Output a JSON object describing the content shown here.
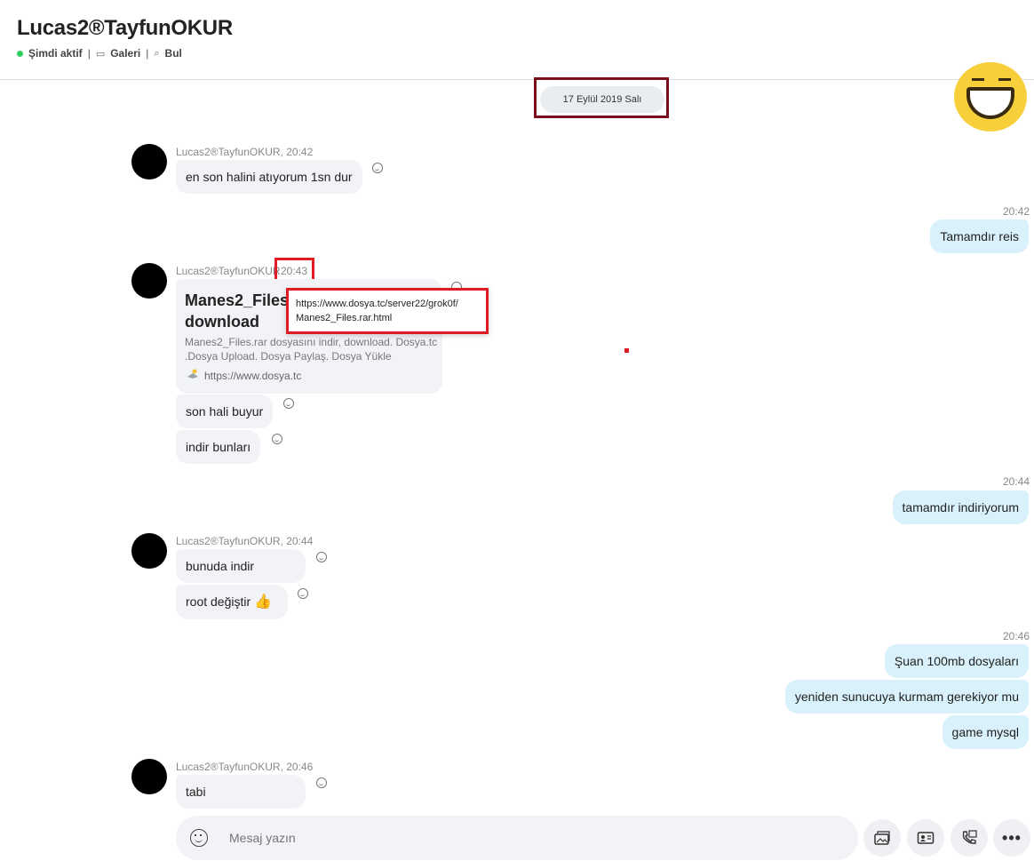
{
  "header": {
    "title": "Lucas2®TayfunOKUR",
    "status": "Şimdi aktif",
    "gallery": "Galeri",
    "find": "Bul",
    "separator": "|"
  },
  "date_separator": "17 Eylül 2019 Salı",
  "messages": {
    "g1": {
      "sender": "Lucas2®TayfunOKUR, 20:42",
      "m1": "en son halini atıyorum 1sn dur"
    },
    "r1": {
      "time": "20:42",
      "m1": "Tamamdır reis"
    },
    "g2": {
      "sender": "Lucas2®TayfunOKUR",
      "time": "20:43",
      "card": {
        "title": "Manes2_Files.",
        "title_line2": "download",
        "description": "Manes2_Files.rar dosyasını indir, download. Dosya.tc .Dosya Upload. Dosya Paylaş. Dosya Yükle",
        "link": "https://www.dosya.tc"
      },
      "tooltip_line1": "https://www.dosya.tc/server22/grok0f/",
      "tooltip_line2": "Manes2_Files.rar.html",
      "m1": "son hali buyur",
      "m2": "indir bunları"
    },
    "r2": {
      "time": "20:44",
      "m1": "tamamdır indiriyorum"
    },
    "g3": {
      "sender": "Lucas2®TayfunOKUR, 20:44",
      "m1": "bunuda indir",
      "m2": "root değiştir",
      "m2_emoji": "👍"
    },
    "r3": {
      "time": "20:46",
      "m1": "Şuan 100mb dosyaları",
      "m2": "yeniden sunucuya kurmam gerekiyor mu",
      "m3": "game mysql"
    },
    "g4": {
      "sender": "Lucas2®TayfunOKUR, 20:46",
      "m1": "tabi"
    }
  },
  "composer": {
    "placeholder": "Mesaj yazın"
  },
  "icons": {
    "status_dot": "online-dot",
    "gallery": "gallery-icon",
    "find": "search-icon",
    "react": "smiley-react-icon",
    "media": "media-icon",
    "contact": "contact-card-icon",
    "schedule": "schedule-call-icon",
    "more": "more-icon"
  },
  "colors": {
    "online": "#2fce5c",
    "incoming_bubble": "#f1f3f6",
    "outgoing_bubble": "#d8f1fb",
    "highlight_red": "#e01b24",
    "highlight_dark_red": "#7a0d1c"
  }
}
